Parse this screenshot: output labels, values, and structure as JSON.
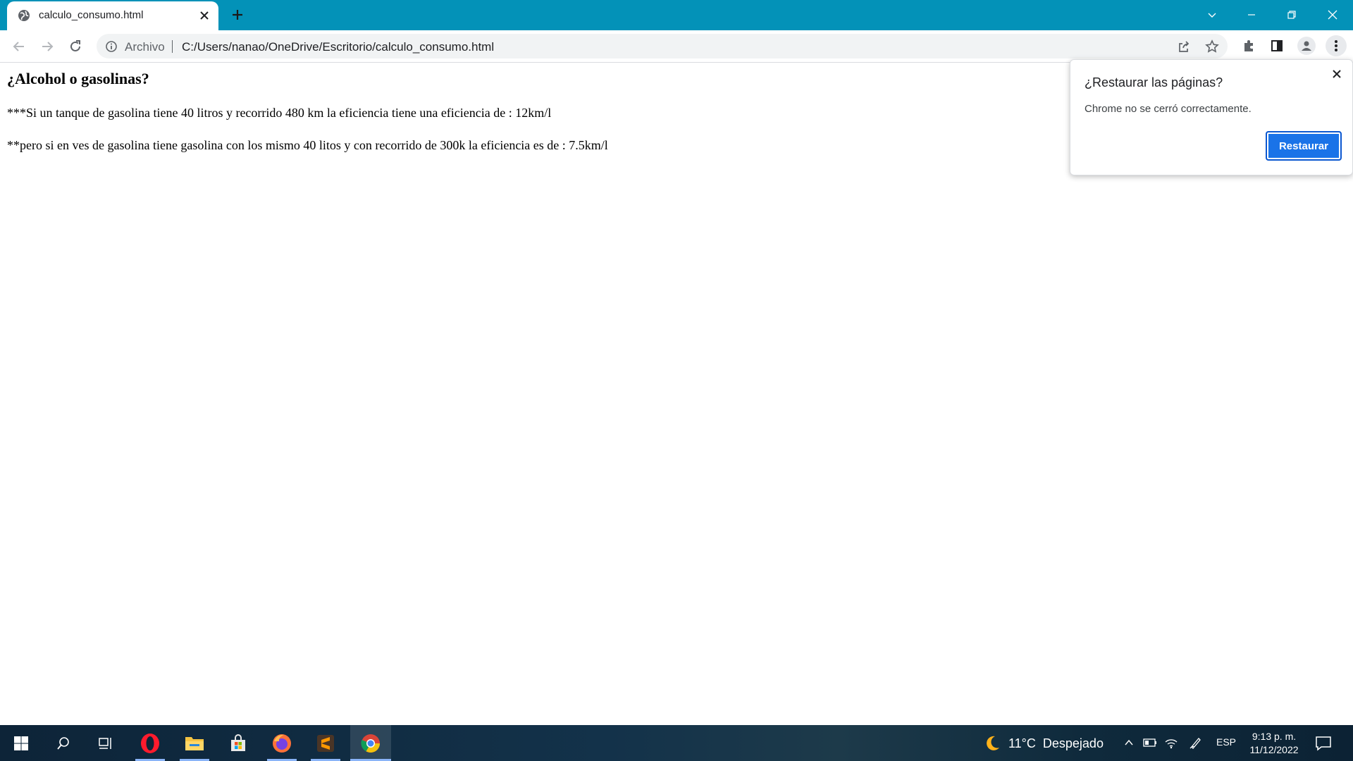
{
  "browser": {
    "tab_title": "calculo_consumo.html",
    "address": {
      "chip": "Archivo",
      "url": "C:/Users/nanao/OneDrive/Escritorio/calculo_consumo.html"
    },
    "accent_color": "#0392b8"
  },
  "page": {
    "heading": "¿Alcohol o gasolinas?",
    "paragraph1": "***Si un tanque de gasolina tiene 40 litros y recorrido 480 km la eficiencia tiene una eficiencia de : 12km/l",
    "paragraph2": "**pero si en ves de gasolina tiene gasolina con los mismo 40 litos y con recorrido de 300k la eficiencia es de : 7.5km/l"
  },
  "restore_popup": {
    "title": "¿Restaurar las páginas?",
    "message": "Chrome no se cerró correctamente.",
    "button_label": "Restaurar",
    "button_color": "#1a73e8"
  },
  "taskbar": {
    "apps": [
      "start-icon",
      "search-icon",
      "task-view-icon",
      "opera-icon",
      "file-explorer-icon",
      "microsoft-store-icon",
      "firefox-icon",
      "sublime-text-icon",
      "chrome-icon"
    ],
    "weather": {
      "temperature": "11°C",
      "condition": "Despejado"
    },
    "language": "ESP",
    "time": "9:13 p. m.",
    "date": "11/12/2022"
  }
}
